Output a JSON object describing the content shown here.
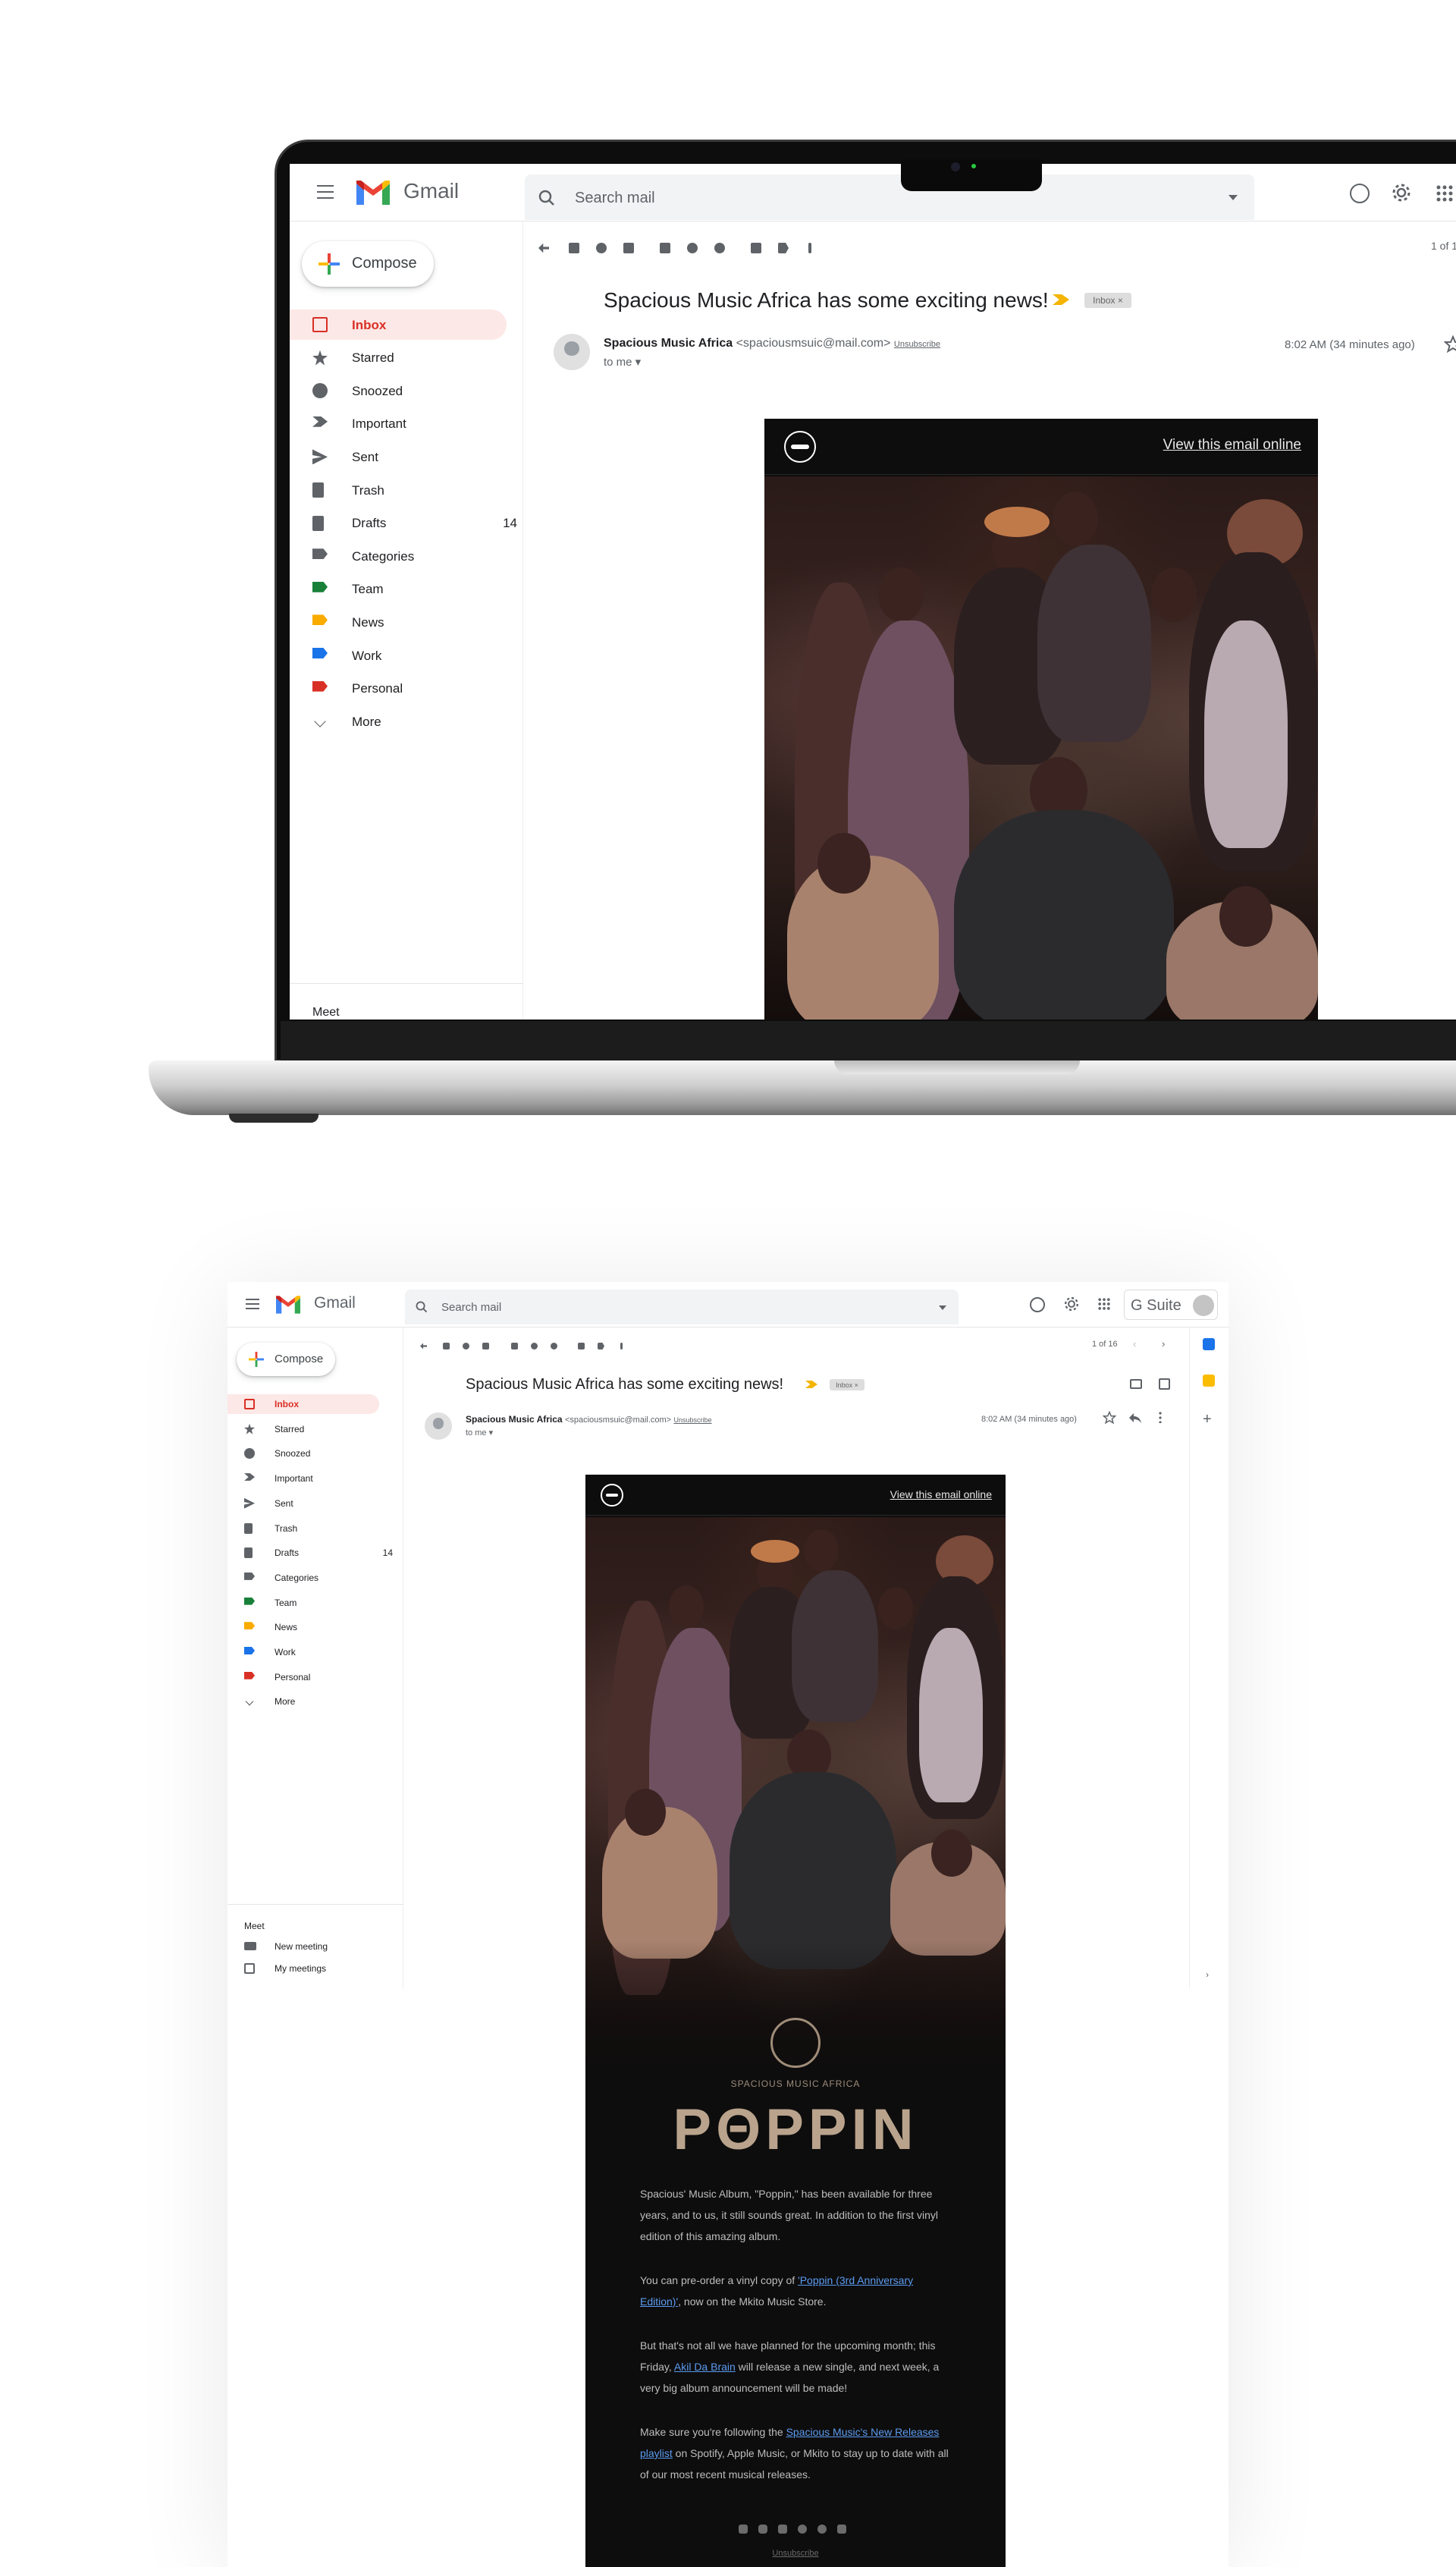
{
  "gmail": {
    "app_name": "Gmail",
    "search_placeholder": "Search mail",
    "compose_label": "Compose",
    "gsuite_label": "G Suite",
    "sidebar": [
      {
        "label": "Inbox",
        "icon": "inbox-icon",
        "active": true
      },
      {
        "label": "Starred",
        "icon": "star-icon"
      },
      {
        "label": "Snoozed",
        "icon": "clock-icon"
      },
      {
        "label": "Important",
        "icon": "important-icon"
      },
      {
        "label": "Sent",
        "icon": "send-icon"
      },
      {
        "label": "Trash",
        "icon": "trash-icon"
      },
      {
        "label": "Drafts",
        "icon": "draft-icon",
        "count": "14"
      },
      {
        "label": "Categories",
        "icon": "label-icon"
      },
      {
        "label": "Team",
        "icon": "label-icon",
        "color": "#188038"
      },
      {
        "label": "News",
        "icon": "label-icon",
        "color": "#f9ab00"
      },
      {
        "label": "Work",
        "icon": "label-icon",
        "color": "#1a73e8"
      },
      {
        "label": "Personal",
        "icon": "label-icon",
        "color": "#d93025"
      },
      {
        "label": "More",
        "icon": "chevron-down-icon"
      }
    ],
    "meet": {
      "heading": "Meet",
      "new_meeting": "New meeting",
      "my_meetings": "My meetings"
    },
    "pagination": "1 of 16",
    "pagination_cut": "1 of 1",
    "email": {
      "subject": "Spacious Music Africa has some exciting news!",
      "label_chip": "Inbox ×",
      "sender_name": "Spacious Music Africa",
      "sender_email": "<spaciousmsuic@mail.com>",
      "unsubscribe": "Unsubscribe",
      "to": "to me",
      "date": "8:02 AM (34 minutes ago)"
    }
  },
  "newsletter": {
    "view_online": "View this email online",
    "brand": "SPACIOUS MUSIC AFRICA",
    "album_logo": "PΘPPIN",
    "paragraphs": [
      {
        "text": "Spacious' Music Album, \"Poppin,\" has been available for three years, and to us, it still sounds great. In addition to the first vinyl edition of this amazing album."
      },
      {
        "before": "You can pre-order a vinyl copy of ",
        "link": "'Poppin (3rd Anniversary Edition)'",
        "after": ", now on the Mkito Music Store."
      },
      {
        "before": "But that's not all we have planned for the upcoming month; this Friday, ",
        "link": "Akil Da Brain",
        "after": " will release a new single, and next week, a very big album announcement will be made!"
      },
      {
        "before": "Make sure you're following the ",
        "link": "Spacious Music's New Releases playlist",
        "after": " on Spotify, Apple Music, or Mkito to stay up to date with all of our most recent musical releases."
      }
    ],
    "footer_unsubscribe": "Unsubscribe",
    "social_icons": [
      "twitter-icon",
      "instagram-icon",
      "facebook-icon",
      "pinterest-icon",
      "spotify-icon",
      "medium-icon"
    ]
  },
  "colors": {
    "gmail_red": "#d93025",
    "active_bg": "#fce8e6",
    "newsletter_bg": "#0e0d0d",
    "album_logo": "#b9a38c",
    "link": "#5a9bf0"
  }
}
